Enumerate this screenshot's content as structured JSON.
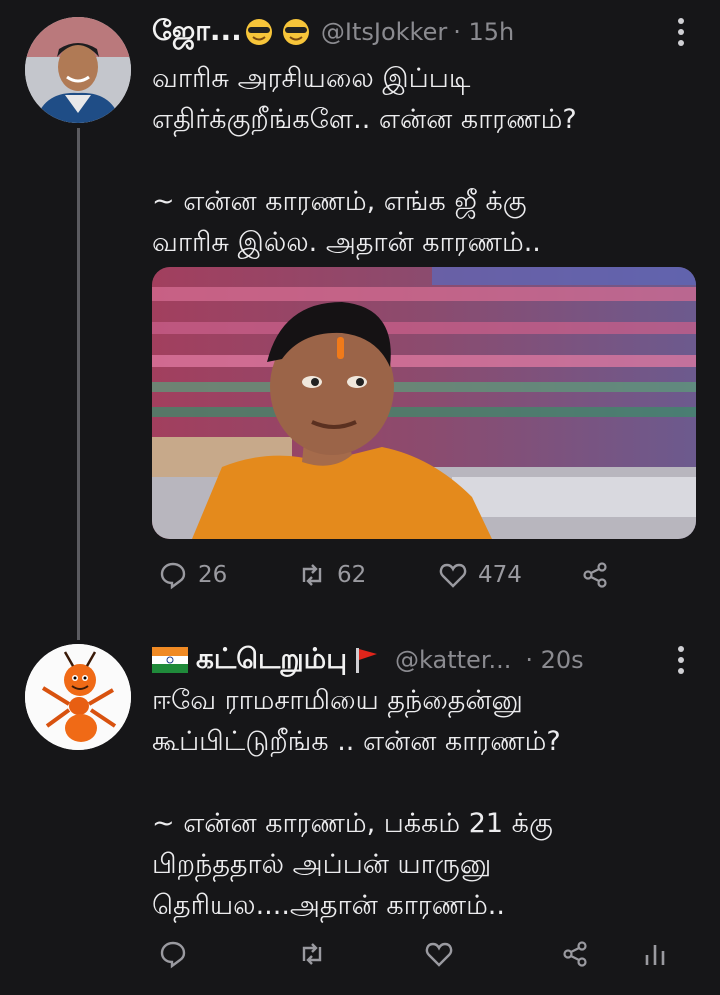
{
  "tweets": [
    {
      "display_name": "ஜோ...",
      "handle": "@ItsJokker",
      "time": "· 15h",
      "lines": [
        "வாரிசு அரசியலை இப்படி",
        "எதிர்க்குறீங்களே.. என்ன காரணம்?",
        "",
        "~ என்ன காரணம், எங்க ஜீ க்கு",
        "வாரிசு இல்ல. அதான் காரணம்.."
      ],
      "replies": "26",
      "retweets": "62",
      "likes": "474"
    },
    {
      "display_name": "கட்டெறும்பு",
      "handle": "@katter...",
      "time": "· 20s",
      "lines": [
        "ஈவே ராமசாமியை தந்தைன்னு",
        "கூப்பிட்டுறீங்க .. என்ன காரணம்?",
        "",
        "~ என்ன காரணம், பக்கம் 21 க்கு",
        "பிறந்ததால் அப்பன் யாருனு",
        "தெரியல....அதான் காரணம்.."
      ]
    }
  ],
  "icons": {
    "reply": "reply-icon",
    "retweet": "retweet-icon",
    "like": "heart-icon",
    "share": "share-icon",
    "analytics": "analytics-icon",
    "menu": "more-icon"
  },
  "colors": {
    "background": "#161618",
    "text": "#e9e9ea",
    "muted": "#8b8b90",
    "thread_line": "#5b5b60"
  }
}
